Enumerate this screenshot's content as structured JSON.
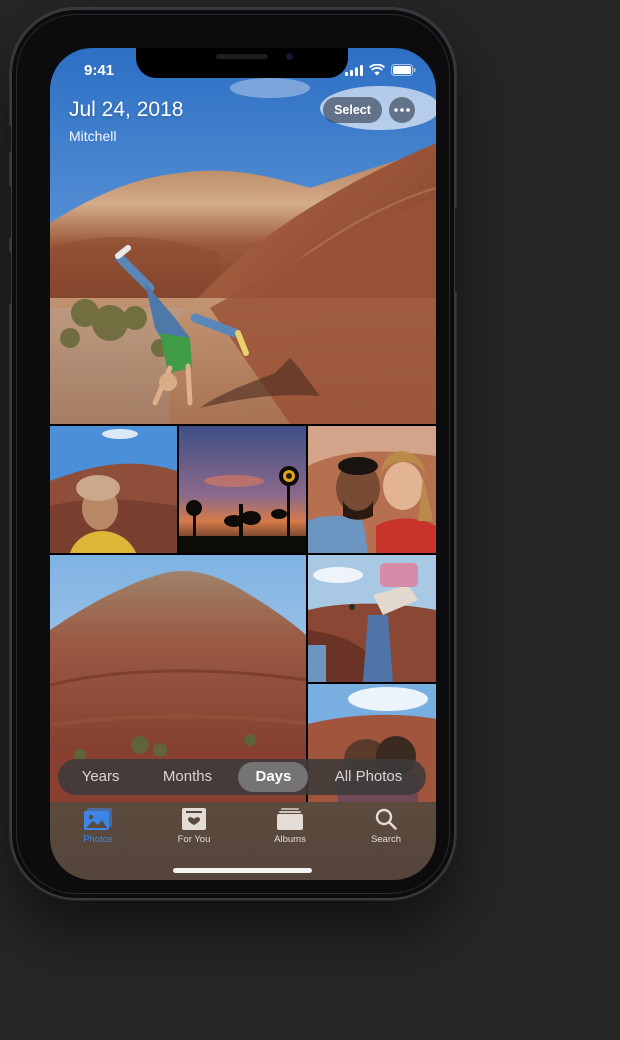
{
  "status": {
    "time": "9:41"
  },
  "header": {
    "date": "Jul 24, 2018",
    "subtitle": "Mitchell"
  },
  "actions": {
    "select_label": "Select",
    "more_icon": "ellipsis-icon"
  },
  "view_modes": [
    "Years",
    "Months",
    "Days",
    "All Photos"
  ],
  "active_view_mode": "Days",
  "tabs": [
    {
      "label": "Photos",
      "icon": "photos-icon",
      "active": true
    },
    {
      "label": "For You",
      "icon": "for-you-icon",
      "active": false
    },
    {
      "label": "Albums",
      "icon": "albums-icon",
      "active": false
    },
    {
      "label": "Search",
      "icon": "search-icon",
      "active": false
    }
  ],
  "colors": {
    "accent": "#3d86e8",
    "tabbar": "#5a4a3e",
    "segment_bg": "#3c3a3a"
  }
}
